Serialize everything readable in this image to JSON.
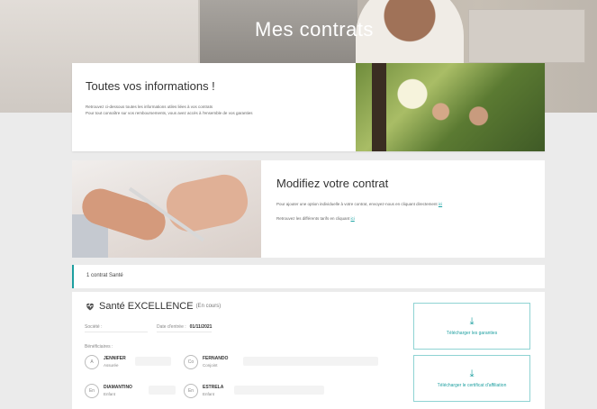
{
  "hero": {
    "title": "Mes contrats",
    "shelf_text_1": "",
    "shelf_text_2": ""
  },
  "info_card": {
    "title": "Toutes vos informations !",
    "line_1": "Retrouvez ci-dessous toutes les informations utiles liées à vos contrats",
    "line_2": "Pour tout connaître sur vos remboursements, vous avez accès à l'ensemble de vos garanties"
  },
  "edit_card": {
    "title": "Modifiez votre contrat",
    "line_1": "Pour ajouter une option individuelle à votre contrat, envoyez-nous en cliquant directement",
    "line_1_link": "ici",
    "line_2": "Retrouvez les différents tarifs en cliquant",
    "line_2_link": "ici"
  },
  "contract_count": "1 contrat Santé",
  "contract": {
    "title": "Santé EXCELLENCE",
    "status": "(En cours)",
    "society_label": "Société :",
    "date_label": "Date d'entrée :",
    "date_value": "01/11/2021",
    "beneficiaries_label": "Bénéficiaires :",
    "beneficiaries": [
      {
        "name": "JENNIFER",
        "role": "Assurée",
        "initials": "A"
      },
      {
        "name": "FERNANDO",
        "role": "Conjoint",
        "initials": "Co"
      },
      {
        "name": "DIAMANTINO",
        "role": "Enfant",
        "initials": "En"
      },
      {
        "name": "ESTRELA",
        "role": "Enfant",
        "initials": "En"
      }
    ],
    "download_guarantees": "Télécharger les garanties",
    "download_certificate": "Télécharger le certificat d'affiliation"
  },
  "colors": {
    "accent": "#1d9fa0",
    "accent_light": "#8fd3d3"
  },
  "icons": {
    "heart": "heartbeat-icon",
    "download": "download-icon"
  }
}
